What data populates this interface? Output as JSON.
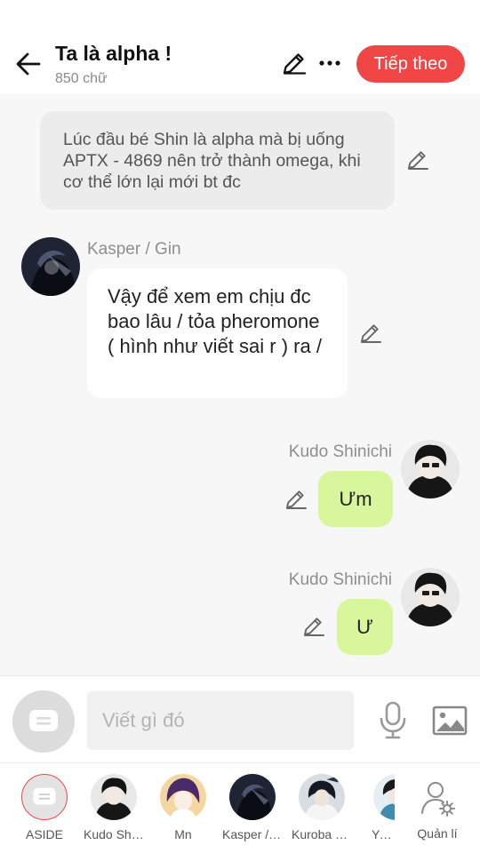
{
  "header": {
    "title": "Ta là alpha !",
    "word_count": "850 chữ",
    "next_label": "Tiếp theo"
  },
  "messages": {
    "narration": "Lúc đầu bé Shin là alpha mà bị uống APTX - 4869 nên trở thành omega, khi cơ thể lớn lại mới bt đc",
    "m1": {
      "sender": "Kasper / Gin",
      "text": "Vậy để xem em chịu đc bao lâu / tỏa pheromone ( hình như viết sai r ) ra /"
    },
    "m2": {
      "sender": "Kudo Shinichi",
      "text": "Ưm"
    },
    "m3": {
      "sender": "Kudo Shinichi",
      "text": "Ư"
    }
  },
  "composer": {
    "placeholder": "Viết gì đó"
  },
  "characters": [
    {
      "label": "ASIDE"
    },
    {
      "label": "Kudo Shinichi"
    },
    {
      "label": "Mn"
    },
    {
      "label": "Kasper / Gin"
    },
    {
      "label": "Kuroba Kaito"
    },
    {
      "label": "Yusa"
    },
    {
      "label": "Quản lí"
    }
  ],
  "colors": {
    "accent": "#f04646",
    "own_bubble": "#d8f69c",
    "other_bubble": "#ffffff",
    "narration_bubble": "#ececec"
  },
  "icons": [
    "back-arrow-icon",
    "pencil-icon",
    "more-icon",
    "chat-bubble-icon",
    "mic-icon",
    "image-icon",
    "manage-user-icon"
  ]
}
